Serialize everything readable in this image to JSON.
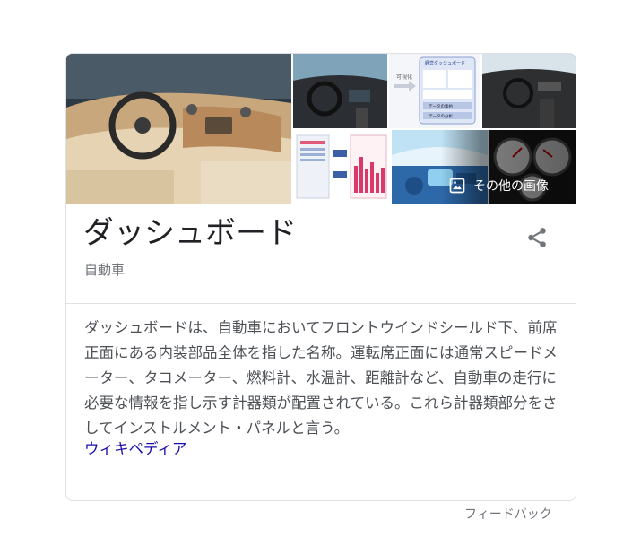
{
  "panel": {
    "title": "ダッシュボード",
    "subtitle": "自動車",
    "description": "ダッシュボードは、自動車においてフロントウインドシールド下、前席正面にある内装部品全体を指した名称。運転席正面には通常スピードメーター、タコメーター、燃料計、水温計、距離計など、自動車の走行に必要な情報を指し示す計器類が配置されている。これら計器類部分をさしてインストルメント・パネルと言う。",
    "source_link": "ウィキペディア",
    "more_images_label": "その他の画像",
    "share_icon": "share-icon",
    "gallery_icon": "image-icon"
  },
  "diagram_text": {
    "arrow_label": "可視化",
    "dashboard_title": "経営ダッシュボード",
    "data_label": "データの集約",
    "decision_label": "データの分析"
  },
  "footer": {
    "feedback": "フィードバック"
  }
}
